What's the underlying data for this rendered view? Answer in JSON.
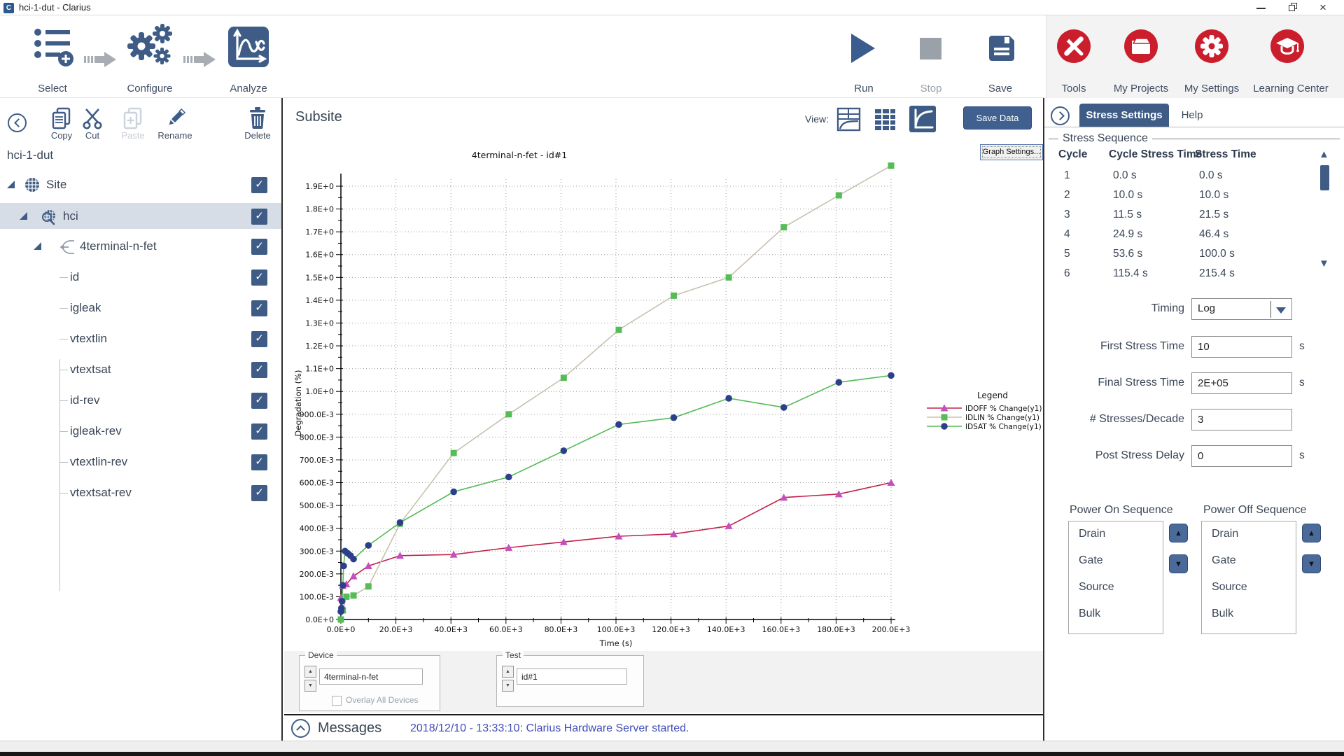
{
  "window": {
    "title": "hci-1-dut - Clarius",
    "app_initial": "C"
  },
  "workflow": {
    "select": "Select",
    "configure": "Configure",
    "analyze": "Analyze"
  },
  "run_controls": {
    "run": "Run",
    "stop": "Stop",
    "save": "Save"
  },
  "app_menu": {
    "tools": "Tools",
    "my_projects": "My Projects",
    "my_settings": "My Settings",
    "learning_center": "Learning Center"
  },
  "tree_toolbar": {
    "copy": "Copy",
    "cut": "Cut",
    "paste": "Paste",
    "rename": "Rename",
    "delete": "Delete"
  },
  "project": {
    "name": "hci-1-dut"
  },
  "tree": {
    "rows": [
      {
        "label": "Site",
        "depth": 0,
        "icon": "wafer",
        "expander": true,
        "checked": true,
        "selected": false
      },
      {
        "label": "hci",
        "depth": 1,
        "icon": "wafer-search",
        "expander": true,
        "checked": true,
        "selected": true
      },
      {
        "label": "4terminal-n-fet",
        "depth": 2,
        "icon": "device",
        "expander": true,
        "checked": true,
        "selected": false
      },
      {
        "label": "id",
        "depth": 3,
        "icon": "none",
        "expander": false,
        "checked": true,
        "selected": false
      },
      {
        "label": "igleak",
        "depth": 3,
        "icon": "none",
        "expander": false,
        "checked": true,
        "selected": false
      },
      {
        "label": "vtextlin",
        "depth": 3,
        "icon": "none",
        "expander": false,
        "checked": true,
        "selected": false
      },
      {
        "label": "vtextsat",
        "depth": 3,
        "icon": "none",
        "expander": false,
        "checked": true,
        "selected": false
      },
      {
        "label": "id-rev",
        "depth": 3,
        "icon": "none",
        "expander": false,
        "checked": true,
        "selected": false
      },
      {
        "label": "igleak-rev",
        "depth": 3,
        "icon": "none",
        "expander": false,
        "checked": true,
        "selected": false
      },
      {
        "label": "vtextlin-rev",
        "depth": 3,
        "icon": "none",
        "expander": false,
        "checked": true,
        "selected": false
      },
      {
        "label": "vtextsat-rev",
        "depth": 3,
        "icon": "none",
        "expander": false,
        "checked": true,
        "selected": false
      }
    ]
  },
  "subsite": {
    "title": "Subsite",
    "view_label": "View:",
    "save_data": "Save Data",
    "graph_settings": "Graph Settings..."
  },
  "chart_data": {
    "type": "line",
    "title": "4terminal-n-fet - id#1",
    "xlabel": "Time (s)",
    "ylabel": "Degradation (%)",
    "xlim": [
      0,
      200000
    ],
    "ylim": [
      0,
      1.9
    ],
    "x_major": 20000,
    "y_major": 0.1,
    "grid": "dotted",
    "legend_title": "Legend",
    "legend_position": "right",
    "series": [
      {
        "name": "IDOFF % Change(y1)",
        "line_color": "#c22049",
        "marker": "triangle",
        "marker_color": "#c44fbe",
        "points": [
          [
            0,
            0.095
          ],
          [
            700,
            0.148
          ],
          [
            2000,
            0.155
          ],
          [
            4600,
            0.19
          ],
          [
            10000,
            0.235
          ],
          [
            21500,
            0.28
          ],
          [
            41000,
            0.285
          ],
          [
            61000,
            0.315
          ],
          [
            81000,
            0.34
          ],
          [
            101000,
            0.365
          ],
          [
            121000,
            0.375
          ],
          [
            141000,
            0.41
          ],
          [
            161000,
            0.535
          ],
          [
            181000,
            0.55
          ],
          [
            200000,
            0.6
          ]
        ]
      },
      {
        "name": "IDLIN % Change(y1)",
        "line_color": "#c8c1af",
        "marker": "square",
        "marker_color": "#56bd56",
        "points": [
          [
            0,
            0
          ],
          [
            700,
            0.04
          ],
          [
            2000,
            0.1
          ],
          [
            4600,
            0.105
          ],
          [
            10000,
            0.145
          ],
          [
            21500,
            0.42
          ],
          [
            41000,
            0.73
          ],
          [
            61000,
            0.9
          ],
          [
            81000,
            1.06
          ],
          [
            101000,
            1.27
          ],
          [
            121000,
            1.42
          ],
          [
            141000,
            1.5
          ],
          [
            161000,
            1.72
          ],
          [
            181000,
            1.86
          ],
          [
            200000,
            1.99
          ]
        ]
      },
      {
        "name": "IDSAT % Change(y1)",
        "line_color": "#55bb55",
        "marker": "circle",
        "marker_color": "#2c3f8a",
        "points": [
          [
            0,
            0.035
          ],
          [
            200,
            0.05
          ],
          [
            400,
            0.08
          ],
          [
            700,
            0.15
          ],
          [
            1000,
            0.235
          ],
          [
            1500,
            0.3
          ],
          [
            2500,
            0.29
          ],
          [
            3500,
            0.28
          ],
          [
            4600,
            0.265
          ],
          [
            10000,
            0.325
          ],
          [
            21500,
            0.425
          ],
          [
            41000,
            0.56
          ],
          [
            61000,
            0.625
          ],
          [
            81000,
            0.74
          ],
          [
            101000,
            0.855
          ],
          [
            121000,
            0.885
          ],
          [
            141000,
            0.97
          ],
          [
            161000,
            0.93
          ],
          [
            181000,
            1.04
          ],
          [
            200000,
            1.07
          ]
        ]
      }
    ]
  },
  "device_test": {
    "device_label": "Device",
    "device_value": "4terminal-n-fet",
    "overlay_label": "Overlay All Devices",
    "overlay_checked": false,
    "test_label": "Test",
    "test_value": "id#1"
  },
  "messages": {
    "label": "Messages",
    "text": "2018/12/10 - 13:33:10: Clarius Hardware Server started."
  },
  "stress_panel": {
    "tabs": {
      "active": "Stress Settings",
      "help": "Help"
    },
    "sequence": {
      "title": "Stress Sequence",
      "columns": [
        "Cycle",
        "Cycle Stress Time",
        "Stress Time"
      ],
      "rows": [
        [
          "1",
          "0.0 s",
          "0.0 s"
        ],
        [
          "2",
          "10.0 s",
          "10.0 s"
        ],
        [
          "3",
          "11.5 s",
          "21.5 s"
        ],
        [
          "4",
          "24.9 s",
          "46.4 s"
        ],
        [
          "5",
          "53.6 s",
          "100.0 s"
        ],
        [
          "6",
          "115.4 s",
          "215.4 s"
        ]
      ]
    },
    "timing": {
      "label": "Timing",
      "value": "Log"
    },
    "fields": [
      {
        "label": "First Stress Time",
        "value": "10",
        "unit": "s"
      },
      {
        "label": "Final Stress Time",
        "value": "2E+05",
        "unit": "s"
      },
      {
        "label": "# Stresses/Decade",
        "value": "3",
        "unit": ""
      },
      {
        "label": "Post Stress Delay",
        "value": "0",
        "unit": "s"
      }
    ],
    "power_on": {
      "title": "Power On Sequence",
      "items": [
        "Drain",
        "Gate",
        "Source",
        "Bulk"
      ]
    },
    "power_off": {
      "title": "Power Off Sequence",
      "items": [
        "Drain",
        "Gate",
        "Source",
        "Bulk"
      ]
    }
  },
  "colors": {
    "accent": "#3e5c85",
    "red": "#cb1e2d",
    "selected_row": "#d6dde7",
    "message_text": "#3f4db8"
  }
}
